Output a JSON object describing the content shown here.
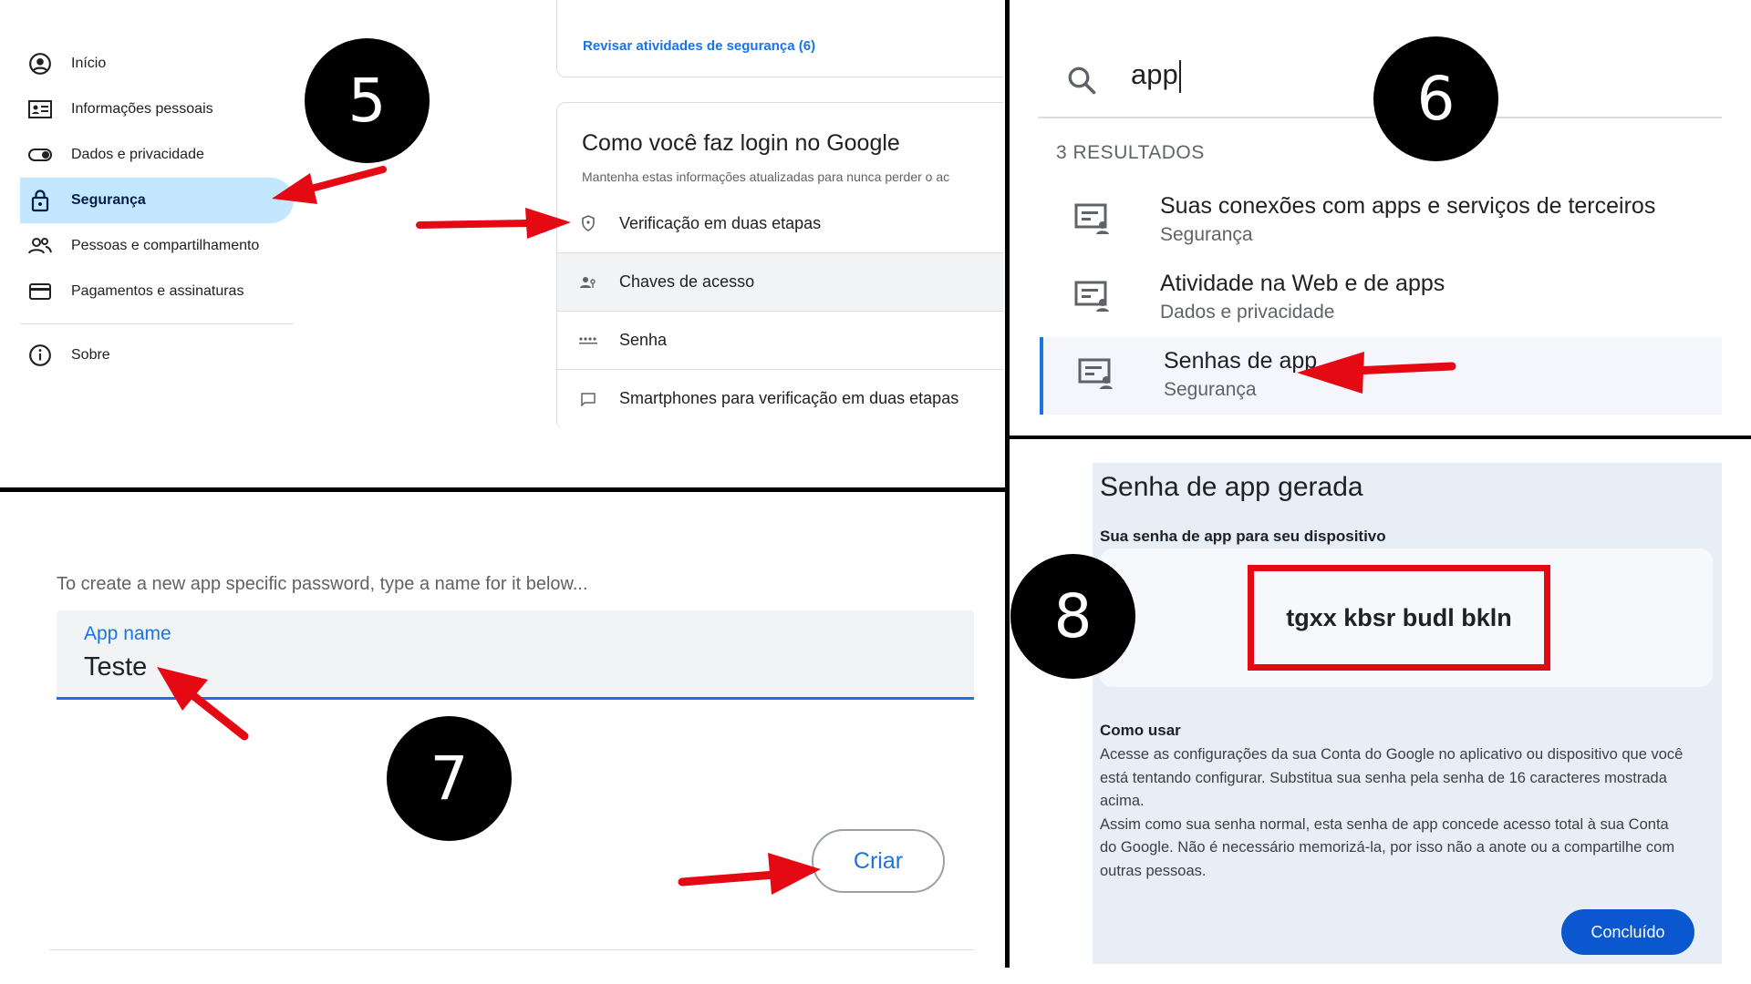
{
  "panel5": {
    "badge": "5",
    "sidebar": {
      "items": [
        {
          "label": "Início",
          "icon": "account-circle-icon"
        },
        {
          "label": "Informações pessoais",
          "icon": "id-card-icon"
        },
        {
          "label": "Dados e privacidade",
          "icon": "toggle-icon"
        },
        {
          "label": "Segurança",
          "icon": "lock-icon",
          "active": true
        },
        {
          "label": "Pessoas e compartilhamento",
          "icon": "people-icon"
        },
        {
          "label": "Pagamentos e assinaturas",
          "icon": "credit-card-icon"
        },
        {
          "label": "Sobre",
          "icon": "info-icon"
        }
      ]
    },
    "review_link": "Revisar atividades de segurança (6)",
    "login_card": {
      "title": "Como você faz login no Google",
      "subtitle": "Mantenha estas informações atualizadas para nunca perder o ac",
      "rows": [
        {
          "label": "Verificação em duas etapas",
          "icon": "shield-icon"
        },
        {
          "label": "Chaves de acesso",
          "icon": "passkey-icon"
        },
        {
          "label": "Senha",
          "icon": "password-dots-icon"
        },
        {
          "label": "Smartphones para verificação em duas etapas",
          "icon": "chat-icon"
        }
      ]
    }
  },
  "panel6": {
    "badge": "6",
    "search": {
      "value": "app",
      "icon": "search-icon"
    },
    "results_count": "3 RESULTADOS",
    "results": [
      {
        "title": "Suas conexões com apps e serviços de terceiros",
        "section": "Segurança",
        "icon": "manage-account-icon"
      },
      {
        "title": "Atividade na Web e de apps",
        "section": "Dados e privacidade",
        "icon": "manage-account-icon"
      },
      {
        "title": "Senhas de app",
        "section": "Segurança",
        "icon": "manage-account-icon",
        "active": true
      }
    ]
  },
  "panel7": {
    "badge": "7",
    "prompt": "To create a new app specific password, type a name for it below...",
    "field_label": "App name",
    "field_value": "Teste",
    "create_button": "Criar"
  },
  "panel8": {
    "badge": "8",
    "title": "Senha de app gerada",
    "subtitle": "Sua senha de app para seu dispositivo",
    "password": "tgxx kbsr budl bkln",
    "how_to_title": "Como usar",
    "how_to_p1": "Acesse as configurações da sua Conta do Google no aplicativo ou dispositivo que você está tentando configurar. Substitua sua senha pela senha de 16 caracteres mostrada acima.",
    "how_to_p2": "Assim como sua senha normal, esta senha de app concede acesso total à sua Conta do Google. Não é necessário memorizá-la, por isso não a anote ou a compartilhe com outras pessoas.",
    "done_button": "Concluído"
  },
  "colors": {
    "accent_blue": "#1a73e8",
    "active_nav": "#c2e7ff",
    "annotation_red": "#e50914",
    "done_button": "#0b57d0"
  }
}
